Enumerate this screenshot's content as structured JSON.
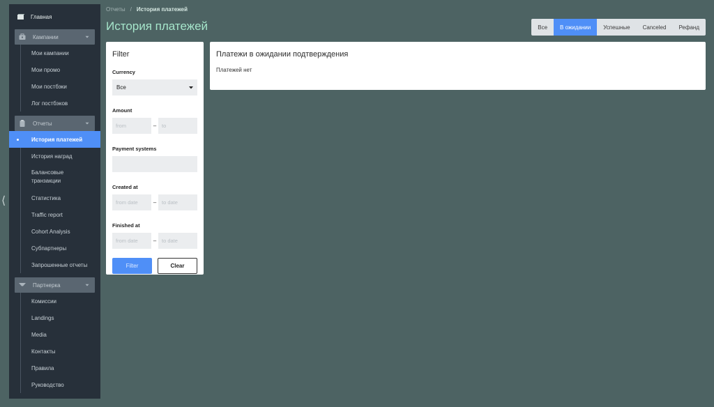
{
  "sidebar": {
    "home_label": "Главная",
    "groups": [
      {
        "label": "Кампании",
        "items": [
          "Мои кампании",
          "Мои промо",
          "Мои постбэки",
          "Лог постбэков"
        ]
      },
      {
        "label": "Отчеты",
        "items": [
          "История платежей",
          "История наград",
          "Балансовые транзакции",
          "Статистика",
          "Traffic report",
          "Cohort Analysis",
          "Субпартнеры",
          "Запрошенные отчеты"
        ]
      },
      {
        "label": "Партнерка",
        "items": [
          "Комиссии",
          "Landings",
          "Media",
          "Контакты",
          "Правила",
          "Руководство"
        ]
      }
    ]
  },
  "breadcrumb": {
    "parent": "Отчеты",
    "separator": "/",
    "current": "История платежей"
  },
  "page_title": "История платежей",
  "status_tabs": [
    "Все",
    "В ожидании",
    "Успешные",
    "Canceled",
    "Рефанд"
  ],
  "active_status_tab": "В ожидании",
  "filter": {
    "title": "Filter",
    "currency_label": "Currency",
    "currency_value": "Все",
    "amount_label": "Amount",
    "amount_from_placeholder": "from",
    "amount_to_placeholder": "to",
    "range_separator": "–",
    "payment_systems_label": "Payment systems",
    "created_label": "Created at",
    "created_from_placeholder": "from date",
    "created_to_placeholder": "to date",
    "finished_label": "Finished at",
    "finished_from_placeholder": "from date",
    "finished_to_placeholder": "to date",
    "filter_button": "Filter",
    "clear_button": "Clear"
  },
  "payments": {
    "title": "Платежи в ожидании подтверждения",
    "empty_text": "Платежей нет"
  },
  "colors": {
    "background": "#4d6363",
    "sidebar": "#27303a",
    "accent": "#4f8ff7",
    "title": "#a6e6cb"
  }
}
